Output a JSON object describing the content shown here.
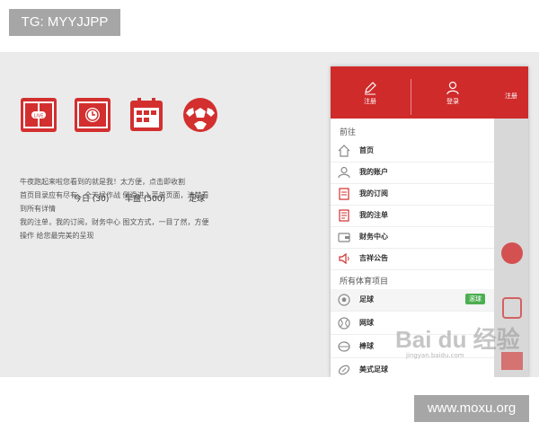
{
  "overlay": {
    "tg_label": "TG: MYYJJPP",
    "site_label": "www.moxu.org"
  },
  "colors": {
    "brand_red": "#cf2b2b",
    "badge_green": "#4caf50"
  },
  "features": [
    {
      "icon": "live-field-icon",
      "label": ""
    },
    {
      "icon": "today-field-icon",
      "label": "今日 (30)"
    },
    {
      "icon": "early-calendar-icon",
      "label": "早盘 (500)"
    },
    {
      "icon": "soccer-ball-icon",
      "label": "足球"
    }
  ],
  "description": [
    "牛夜跑起来啦您看到的就是我！太方便，点击即收割",
    "首页目录应有尽有，全天候作战 侧滑进入菜单页面，清楚看",
    "到所有详情",
    "我的注单，我的订阅，财务中心 图文方式，一目了然，方便",
    "操作 给您最完美的呈现"
  ],
  "drawer": {
    "register_label": "注册",
    "login_label": "登录",
    "behind_label": "注册",
    "section_goto": "前往",
    "menu": [
      {
        "icon": "home-icon",
        "label": "首页"
      },
      {
        "icon": "user-icon",
        "label": "我的账户"
      },
      {
        "icon": "document-icon",
        "label": "我的订阅"
      },
      {
        "icon": "note-icon",
        "label": "我的注单"
      },
      {
        "icon": "wallet-icon",
        "label": "财务中心"
      },
      {
        "icon": "speaker-icon",
        "label": "吉祥公告"
      }
    ],
    "section_sports": "所有体育项目",
    "sports": [
      {
        "icon": "soccer-icon",
        "label": "足球",
        "badge": "滚球"
      },
      {
        "icon": "tennis-icon",
        "label": "网球",
        "badge": ""
      },
      {
        "icon": "baseball-icon",
        "label": "棒球",
        "badge": ""
      },
      {
        "icon": "football-icon",
        "label": "美式足球",
        "badge": ""
      }
    ]
  },
  "watermark": {
    "text": "Bai du 经验",
    "sub": "jingyan.baidu.com"
  }
}
